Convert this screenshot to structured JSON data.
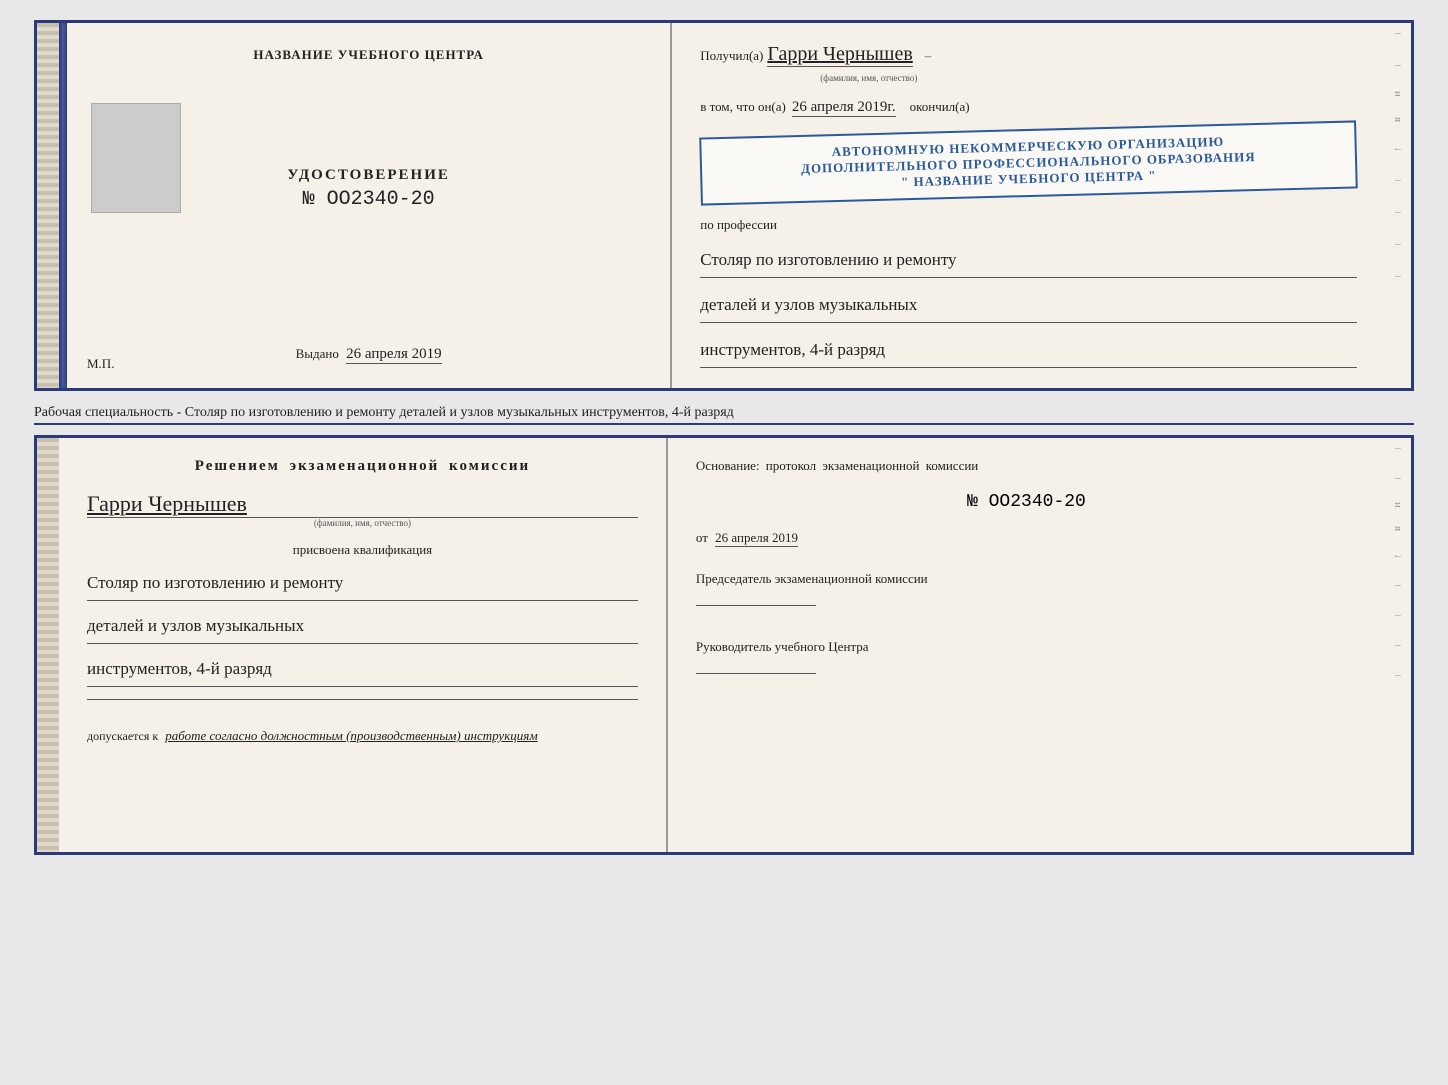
{
  "top_booklet": {
    "left": {
      "title": "НАЗВАНИЕ УЧЕБНОГО ЦЕНТРА",
      "certificate_label": "УДОСТОВЕРЕНИЕ",
      "certificate_num": "№ OO2340-20",
      "vydano_label": "Выдано",
      "vydano_date": "26 апреля 2019",
      "mp_label": "М.П."
    },
    "right": {
      "poluchil_label": "Получил(а)",
      "recipient_name": "Гарри Чернышев",
      "fio_sublabel": "(фамилия, имя, отчество)",
      "vtom_prefix": "в том, что он(a)",
      "date_value": "26 апреля 2019г.",
      "okonchil_label": "окончил(а)",
      "stamp_line1": "АВТОНОМНУЮ НЕКОММЕРЧЕСКУЮ ОРГАНИЗАЦИЮ",
      "stamp_line2": "ДОПОЛНИТЕЛЬНОГО ПРОФЕССИОНАЛЬНОГО ОБРАЗОВАНИЯ",
      "stamp_line3": "\" НАЗВАНИЕ УЧЕБНОГО ЦЕНТРА \"",
      "po_professii_label": "по профессии",
      "profession_line1": "Столяр по изготовлению и ремонту",
      "profession_line2": "деталей и узлов музыкальных",
      "profession_line3": "инструментов, 4-й разряд"
    }
  },
  "specialty_text": "Рабочая специальность - Столяр по изготовлению и ремонту деталей и узлов музыкальных инструментов, 4-й разряд",
  "bottom_booklet": {
    "left": {
      "resheniem_title": "Решением  экзаменационной  комиссии",
      "name": "Гарри Чернышев",
      "fio_sublabel": "(фамилия, имя, отчество)",
      "prisvoena_label": "присвоена квалификация",
      "qualification_line1": "Столяр по изготовлению и ремонту",
      "qualification_line2": "деталей и узлов музыкальных",
      "qualification_line3": "инструментов, 4-й разряд",
      "dopuskaetsya_prefix": "допускается к",
      "dopuskaetsya_text": "работе согласно должностным (производственным) инструкциям"
    },
    "right": {
      "osnovanie_label": "Основание: протокол экзаменационной  комиссии",
      "num_label": "№  OO2340-20",
      "ot_label": "от",
      "ot_date": "26 апреля 2019",
      "predsedatel_label": "Председатель экзаменационной комиссии",
      "rukovoditel_label": "Руководитель учебного Центра"
    }
  },
  "edge_labels": {
    "i": "и",
    "ya": "я",
    "arrow": "←"
  }
}
